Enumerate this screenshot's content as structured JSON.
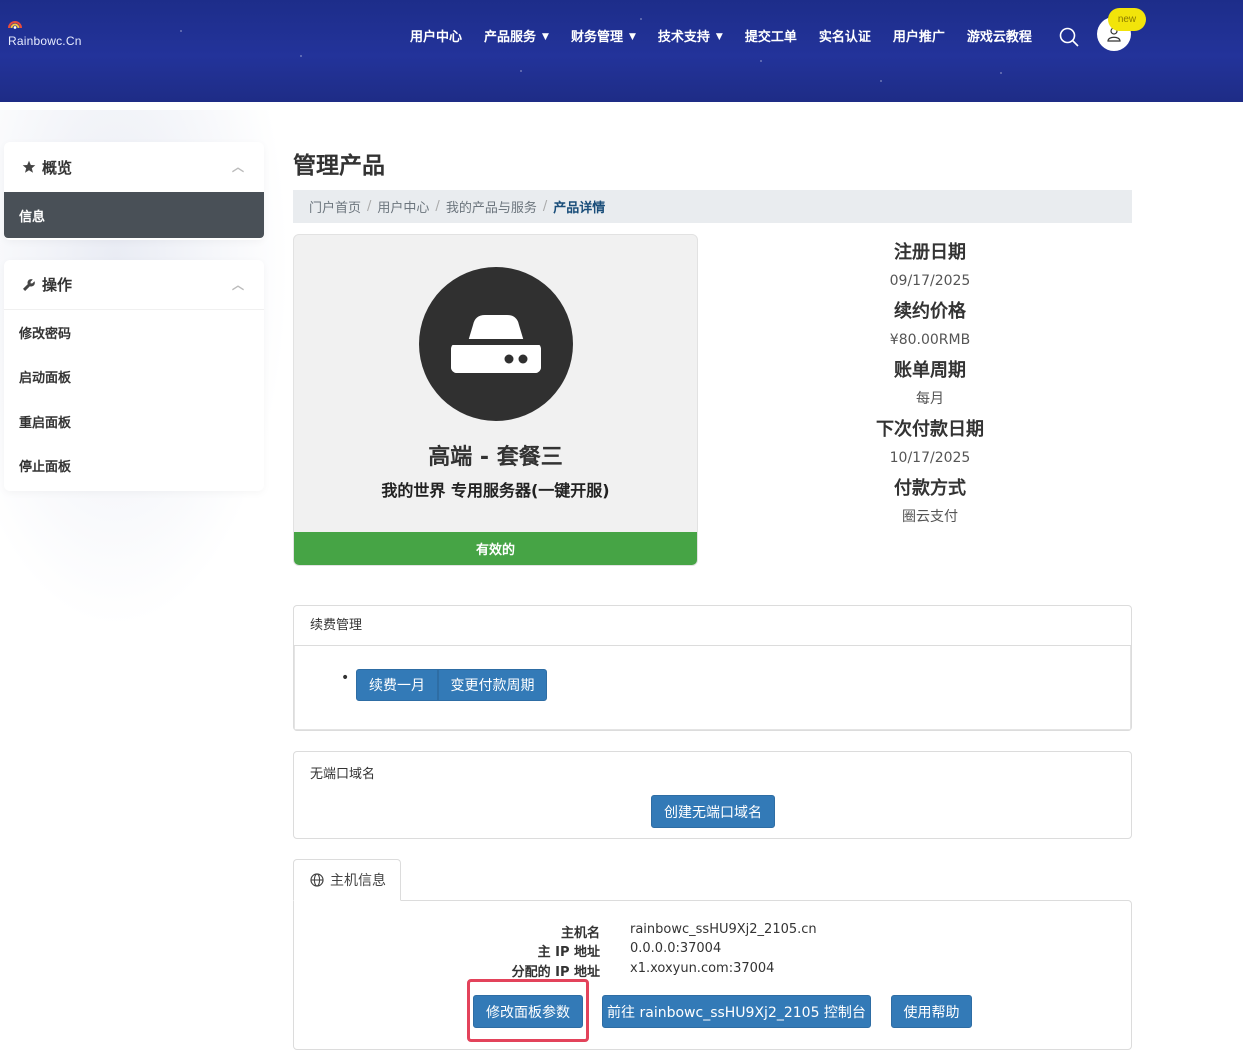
{
  "header": {
    "logo_text": "Rainbowc.Cn",
    "nav": [
      {
        "label": "用户中心",
        "dropdown": false
      },
      {
        "label": "产品服务",
        "dropdown": true
      },
      {
        "label": "财务管理",
        "dropdown": true
      },
      {
        "label": "技术支持",
        "dropdown": true
      },
      {
        "label": "提交工单",
        "dropdown": false
      },
      {
        "label": "实名认证",
        "dropdown": false
      },
      {
        "label": "用户推广",
        "dropdown": false
      },
      {
        "label": "游戏云教程",
        "dropdown": false
      }
    ],
    "badge": "new",
    "icons": {
      "search": "search-icon",
      "user": "user-icon"
    }
  },
  "sidebar": {
    "overview": {
      "title": "概览",
      "icon": "star-icon",
      "items": [
        {
          "label": "信息",
          "active": true
        }
      ]
    },
    "actions": {
      "title": "操作",
      "icon": "wrench-icon",
      "items": [
        {
          "label": "修改密码"
        },
        {
          "label": "启动面板"
        },
        {
          "label": "重启面板"
        },
        {
          "label": "停止面板"
        }
      ]
    }
  },
  "main": {
    "title": "管理产品",
    "breadcrumb": [
      "门户首页",
      "用户中心",
      "我的产品与服务",
      "产品详情"
    ],
    "product": {
      "name": "高端 - 套餐三",
      "group": "我的世界 专用服务器(一键开服)",
      "status": "有效的",
      "icon": "server-icon"
    },
    "details": [
      {
        "label": "注册日期",
        "value": "09/17/2025"
      },
      {
        "label": "续约价格",
        "value": "¥80.00RMB"
      },
      {
        "label": "账单周期",
        "value": "每月"
      },
      {
        "label": "下次付款日期",
        "value": "10/17/2025"
      },
      {
        "label": "付款方式",
        "value": "圈云支付"
      }
    ],
    "renewal": {
      "title": "续费管理",
      "buttons": [
        "续费一月",
        "变更付款周期"
      ]
    },
    "portless": {
      "title": "无端口域名",
      "button": "创建无端口域名"
    },
    "host": {
      "tab": "主机信息",
      "rows": [
        {
          "key": "主机名",
          "value": "rainbowc_ssHU9Xj2_2105.cn"
        },
        {
          "key": "主 IP 地址",
          "value": "0.0.0.0:37004"
        },
        {
          "key": "分配的 IP 地址",
          "value": "x1.xoxyun.com:37004"
        }
      ],
      "buttons": [
        "修改面板参数",
        "前往 rainbowc_ssHU9Xj2_2105 控制台",
        "使用帮助"
      ]
    }
  },
  "colors": {
    "header": "#23339a",
    "accent": "#337ab7",
    "status": "#46a445",
    "highlight": "#e3435b",
    "sidebar_active": "#495057"
  }
}
